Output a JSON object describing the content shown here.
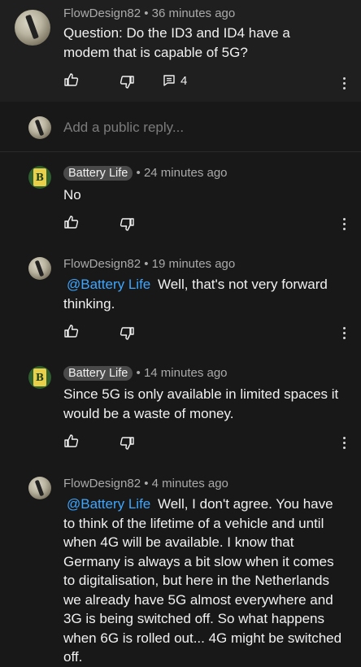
{
  "top_comment": {
    "author": "FlowDesign82",
    "time": "36 minutes ago",
    "text": "Question: Do the ID3 and ID4 have a modem that is capable of 5G?",
    "reply_count": "4"
  },
  "reply_box": {
    "placeholder": "Add a public reply..."
  },
  "replies": [
    {
      "author": "Battery Life",
      "time": "24 minutes ago",
      "mention": "",
      "text": "No"
    },
    {
      "author": "FlowDesign82",
      "time": "19 minutes ago",
      "mention": "@Battery Life",
      "text": "Well, that's not very forward thinking."
    },
    {
      "author": "Battery Life",
      "time": "14 minutes ago",
      "mention": "",
      "text": "Since 5G is only available in limited spaces it would be a waste of money."
    },
    {
      "author": "FlowDesign82",
      "time": "4 minutes ago",
      "mention": "@Battery Life",
      "text": "Well, I don't agree. You have to think of the lifetime of a vehicle and until when 4G will be available. I know that Germany is always a bit slow when it comes to digitalisation, but here in the Netherlands we already have 5G almost everywhere and 3G is being switched off. So what happens when 6G is rolled out... 4G might be switched off."
    }
  ],
  "separator": "•",
  "channel_badge_letter": "B",
  "icons": [
    "thumb-up-icon",
    "thumb-down-icon",
    "reply-icon",
    "more-vert-icon"
  ],
  "colors": {
    "background": "#181818",
    "top_background": "#1f1f1f",
    "mention": "#3ea6ff",
    "chip": "#4a4a4a"
  }
}
